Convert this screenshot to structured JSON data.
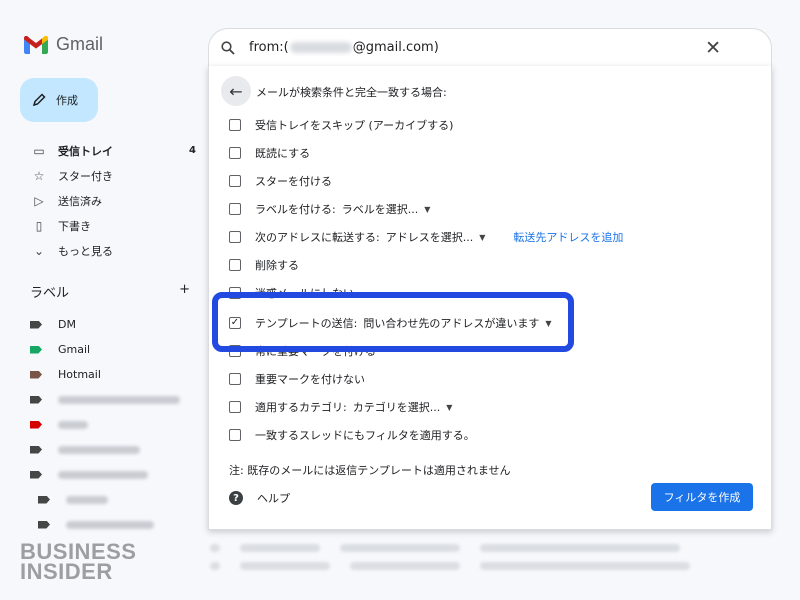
{
  "app": {
    "name": "Gmail"
  },
  "search": {
    "prefix": "from:(",
    "suffix": "@gmail.com)"
  },
  "compose": {
    "label": "作成"
  },
  "nav": [
    {
      "icon": "inbox-icon",
      "label": "受信トレイ",
      "count": "4",
      "bold": true
    },
    {
      "icon": "star-icon",
      "label": "スター付き"
    },
    {
      "icon": "send-icon",
      "label": "送信済み"
    },
    {
      "icon": "draft-icon",
      "label": "下書き"
    },
    {
      "icon": "chevron-down-icon",
      "label": "もっと見る"
    }
  ],
  "labels": {
    "title": "ラベル",
    "add": "+",
    "items": [
      {
        "name": "DM",
        "color": "#444746"
      },
      {
        "name": "Gmail",
        "color": "#16a765"
      },
      {
        "name": "Hotmail",
        "color": "#795548"
      }
    ]
  },
  "filter": {
    "title": "メールが検索条件と完全一致する場合:",
    "options": {
      "skip_inbox": "受信トレイをスキップ (アーカイブする)",
      "mark_read": "既読にする",
      "star": "スターを付ける",
      "apply_label": "ラベルを付ける:",
      "label_select": "ラベルを選択...",
      "forward": "次のアドレスに転送する:",
      "address_select": "アドレスを選択...",
      "add_forward": "転送先アドレスを追加",
      "delete": "削除する",
      "not_spam": "迷惑メールにしない",
      "send_template": "テンプレートの送信:",
      "template_value": "問い合わせ先のアドレスが違います",
      "always_important": "常に重要マークを付ける",
      "never_important": "重要マークを付けない",
      "category": "適用するカテゴリ:",
      "category_select": "カテゴリを選択...",
      "also_apply": "一致するスレッドにもフィルタを適用する。"
    },
    "note": "注: 既存のメールには返信テンプレートは適用されません",
    "help": "ヘルプ",
    "create": "フィルタを作成"
  },
  "watermark": {
    "line1": "BUSINESS",
    "line2": "INSIDER"
  }
}
